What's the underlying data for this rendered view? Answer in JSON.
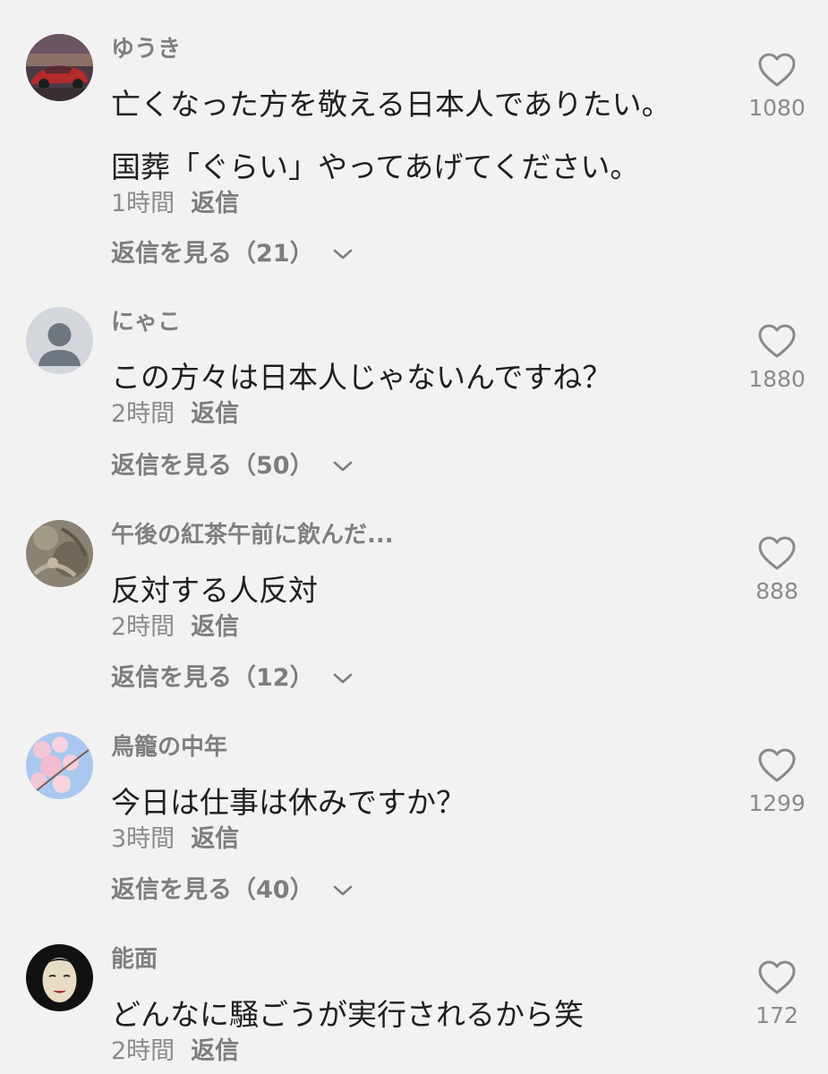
{
  "comments": [
    {
      "username": "ゆうき",
      "avatar": "car-photo-avatar",
      "lines": [
        "亡くなった方を敬える日本人でありたい。",
        "国葬「ぐらい」やってあげてください。"
      ],
      "time": "1時間",
      "reply_label": "返信",
      "view_replies": "返信を見る（21）",
      "likes": "1080"
    },
    {
      "username": "にゃこ",
      "avatar": "default-user-avatar",
      "lines": [
        "この方々は日本人じゃないんですね？"
      ],
      "time": "2時間",
      "reply_label": "返信",
      "view_replies": "返信を見る（50）",
      "likes": "1880"
    },
    {
      "username": "午後の紅茶午前に飲んだ...",
      "avatar": "stone-relief-avatar",
      "lines": [
        "反対する人反対"
      ],
      "time": "2時間",
      "reply_label": "返信",
      "view_replies": "返信を見る（12）",
      "likes": "888"
    },
    {
      "username": "鳥籠の中年",
      "avatar": "cherry-blossom-avatar",
      "lines": [
        "今日は仕事は休みですか？"
      ],
      "time": "3時間",
      "reply_label": "返信",
      "view_replies": "返信を見る（40）",
      "likes": "1299"
    },
    {
      "username": "能面",
      "avatar": "noh-mask-avatar",
      "lines": [
        "どんなに騒ごうが実行されるから笑"
      ],
      "time": "2時間",
      "reply_label": "返信",
      "likes": "172"
    }
  ],
  "colors": {
    "background": "#f2f2f2",
    "text": "#1f1f1f",
    "muted": "#8a8a8a"
  },
  "icons": {
    "like": "heart-outline-icon",
    "expand": "chevron-down-icon"
  }
}
